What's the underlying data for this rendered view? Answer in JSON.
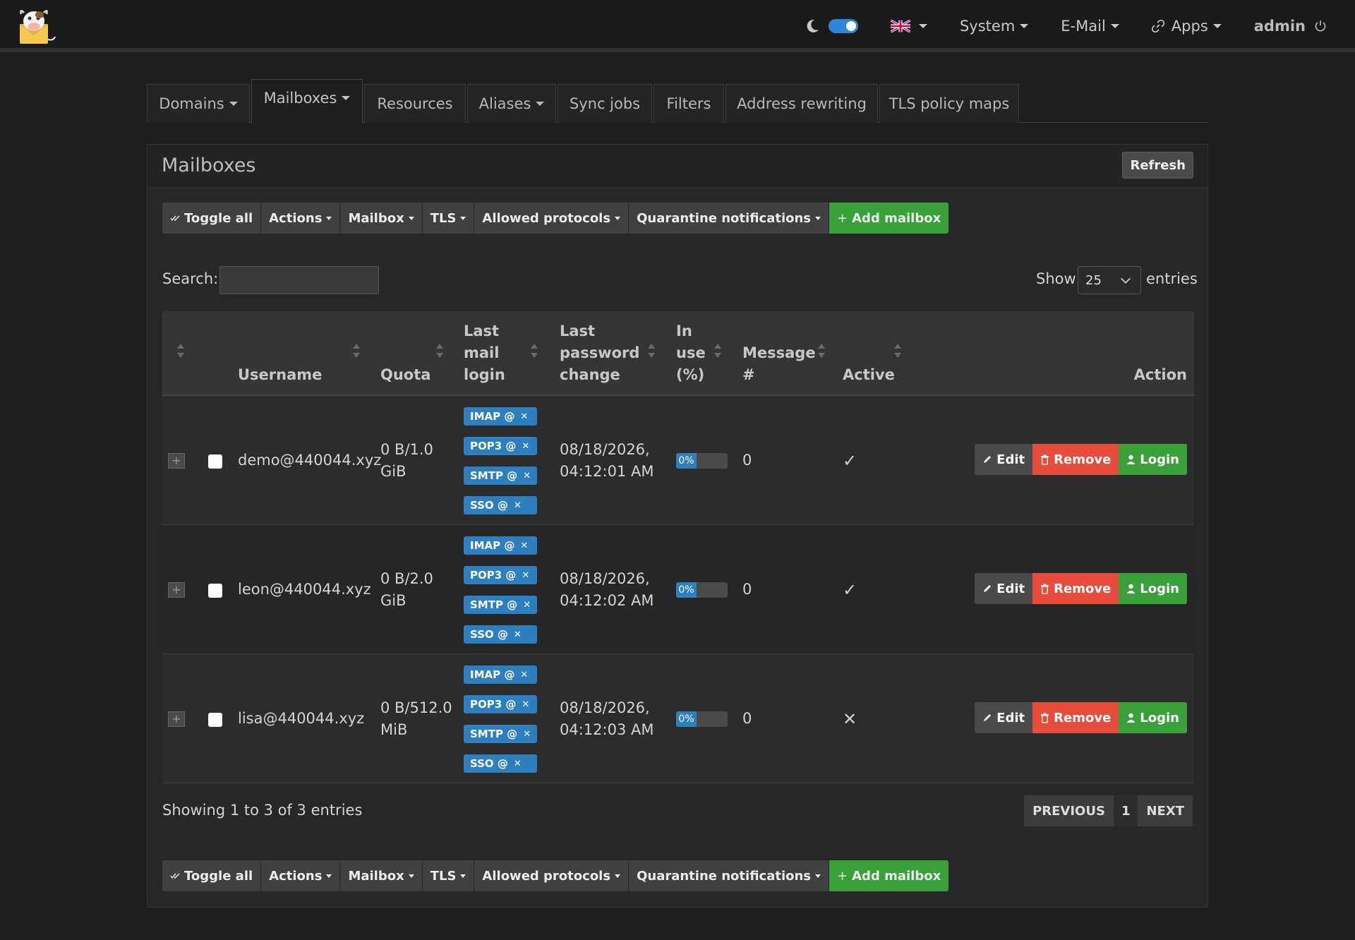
{
  "navbar": {
    "language_flag": "uk-flag-icon",
    "menu": [
      {
        "label": "System"
      },
      {
        "label": "E-Mail"
      },
      {
        "label": "Apps"
      }
    ],
    "user": "admin"
  },
  "tabs": [
    {
      "label": "Domains",
      "dropdown": true
    },
    {
      "label": "Mailboxes",
      "dropdown": true,
      "active": true
    },
    {
      "label": "Resources",
      "dropdown": false
    },
    {
      "label": "Aliases",
      "dropdown": true
    },
    {
      "label": "Sync jobs",
      "dropdown": false
    },
    {
      "label": "Filters",
      "dropdown": false
    },
    {
      "label": "Address rewriting",
      "dropdown": false
    },
    {
      "label": "TLS policy maps",
      "dropdown": false
    }
  ],
  "panel": {
    "title": "Mailboxes",
    "refresh_label": "Refresh"
  },
  "toolbar": {
    "toggle_all": "Toggle all",
    "actions": "Actions",
    "mailbox": "Mailbox",
    "tls": "TLS",
    "allowed_protocols": "Allowed protocols",
    "quarantine": "Quarantine notifications",
    "add_mailbox": "Add mailbox"
  },
  "search": {
    "label": "Search:",
    "value": ""
  },
  "length": {
    "show_label": "Show",
    "value": "25",
    "entries_label": "entries"
  },
  "table": {
    "headers": {
      "username": "Username",
      "quota": "Quota",
      "last_mail_login": "Last mail login",
      "last_password_change": "Last password change",
      "in_use": "In use (%)",
      "message_count": "Message #",
      "active": "Active",
      "action": "Action"
    },
    "rows": [
      {
        "username": "demo@440044.xyz",
        "quota_line1": "0 B/1.0",
        "quota_line2": "GiB",
        "protocols": [
          "IMAP @",
          "POP3 @",
          "SMTP @",
          "SSO @"
        ],
        "pw_change_line1": "08/18/2026,",
        "pw_change_line2": "04:12:01 AM",
        "in_use": "0%",
        "messages": "0",
        "active": "✓"
      },
      {
        "username": "leon@440044.xyz",
        "quota_line1": "0 B/2.0",
        "quota_line2": "GiB",
        "protocols": [
          "IMAP @",
          "POP3 @",
          "SMTP @",
          "SSO @"
        ],
        "pw_change_line1": "08/18/2026,",
        "pw_change_line2": "04:12:02 AM",
        "in_use": "0%",
        "messages": "0",
        "active": "✓"
      },
      {
        "username": "lisa@440044.xyz",
        "quota_line1": "0 B/512.0",
        "quota_line2": "MiB",
        "protocols": [
          "IMAP @",
          "POP3 @",
          "SMTP @",
          "SSO @"
        ],
        "pw_change_line1": "08/18/2026,",
        "pw_change_line2": "04:12:03 AM",
        "in_use": "0%",
        "messages": "0",
        "active": "✕"
      }
    ],
    "row_actions": {
      "edit": "Edit",
      "remove": "Remove",
      "login": "Login"
    }
  },
  "footer": {
    "info": "Showing 1 to 3 of 3 entries",
    "previous": "PREVIOUS",
    "page": "1",
    "next": "NEXT"
  },
  "colors": {
    "accent": "#2e7fbf",
    "success": "#3aa03a",
    "danger": "#e74c3c"
  }
}
